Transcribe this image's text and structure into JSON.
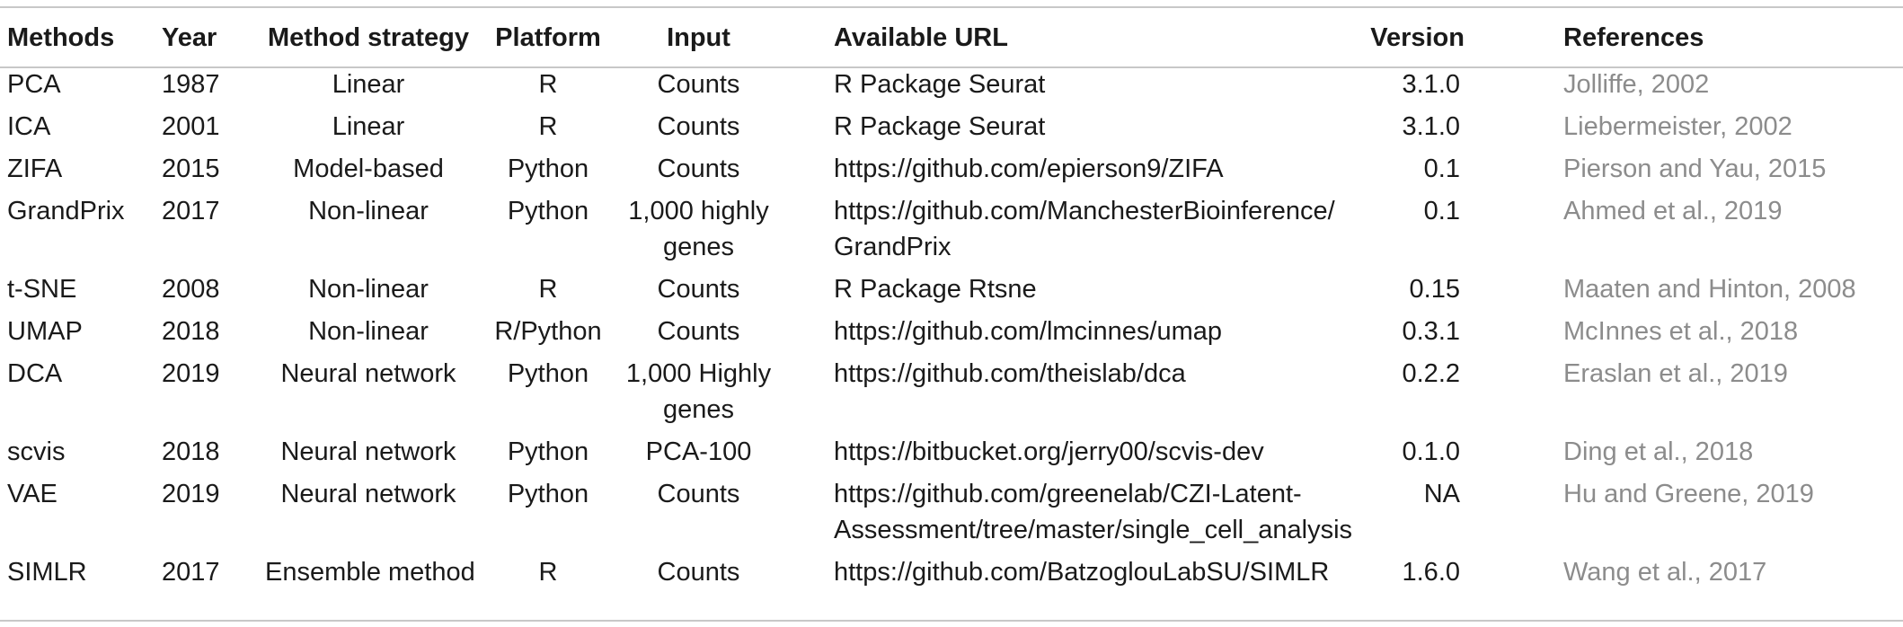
{
  "table": {
    "headers": {
      "methods": "Methods",
      "year": "Year",
      "strategy": "Method strategy",
      "platform": "Platform",
      "input": "Input",
      "url": "Available URL",
      "version": "Version",
      "references": "References"
    },
    "rows": [
      {
        "method": "PCA",
        "year": "1987",
        "strategy": "Linear",
        "platform": "R",
        "input": [
          "Counts"
        ],
        "url": [
          "R Package Seurat"
        ],
        "version": "3.1.0",
        "reference": "Jolliffe, 2002"
      },
      {
        "method": "ICA",
        "year": "2001",
        "strategy": "Linear",
        "platform": "R",
        "input": [
          "Counts"
        ],
        "url": [
          "R Package Seurat"
        ],
        "version": "3.1.0",
        "reference": "Liebermeister, 2002"
      },
      {
        "method": "ZIFA",
        "year": "2015",
        "strategy": "Model-based",
        "platform": "Python",
        "input": [
          "Counts"
        ],
        "url": [
          "https://github.com/epierson9/ZIFA"
        ],
        "version": "0.1",
        "reference": "Pierson and Yau, 2015"
      },
      {
        "method": "GrandPrix",
        "year": "2017",
        "strategy": "Non-linear",
        "platform": "Python",
        "input": [
          "1,000 highly",
          "genes"
        ],
        "url": [
          "https://github.com/ManchesterBioinference/",
          "GrandPrix"
        ],
        "version": "0.1",
        "reference": "Ahmed et al., 2019"
      },
      {
        "method": "t-SNE",
        "year": "2008",
        "strategy": "Non-linear",
        "platform": "R",
        "input": [
          "Counts"
        ],
        "url": [
          "R Package Rtsne"
        ],
        "version": "0.15",
        "reference": "Maaten and Hinton, 2008"
      },
      {
        "method": "UMAP",
        "year": "2018",
        "strategy": "Non-linear",
        "platform": "R/Python",
        "input": [
          "Counts"
        ],
        "url": [
          "https://github.com/lmcinnes/umap"
        ],
        "version": "0.3.1",
        "reference": "McInnes et al., 2018"
      },
      {
        "method": "DCA",
        "year": "2019",
        "strategy": "Neural network",
        "platform": "Python",
        "input": [
          "1,000 Highly",
          "genes"
        ],
        "url": [
          "https://github.com/theislab/dca"
        ],
        "version": "0.2.2",
        "reference": "Eraslan et al., 2019"
      },
      {
        "method": "scvis",
        "year": "2018",
        "strategy": "Neural network",
        "platform": "Python",
        "input": [
          "PCA-100"
        ],
        "url": [
          "https://bitbucket.org/jerry00/scvis-dev"
        ],
        "version": "0.1.0",
        "reference": "Ding et al., 2018"
      },
      {
        "method": "VAE",
        "year": "2019",
        "strategy": "Neural network",
        "platform": "Python",
        "input": [
          "Counts"
        ],
        "url": [
          "https://github.com/greenelab/CZI-Latent-",
          "Assessment/tree/master/single_cell_analysis"
        ],
        "version": "NA",
        "reference": "Hu and Greene, 2019"
      },
      {
        "method": "SIMLR",
        "year": "2017",
        "strategy": "Ensemble method",
        "platform": "R",
        "input": [
          "Counts"
        ],
        "url": [
          "https://github.com/BatzoglouLabSU/SIMLR"
        ],
        "version": "1.6.0",
        "reference": "Wang et al., 2017"
      }
    ]
  },
  "colors": {
    "text": "#1a1a1a",
    "reference_text": "#8c8c8c",
    "rule": "#c8c8c8"
  }
}
